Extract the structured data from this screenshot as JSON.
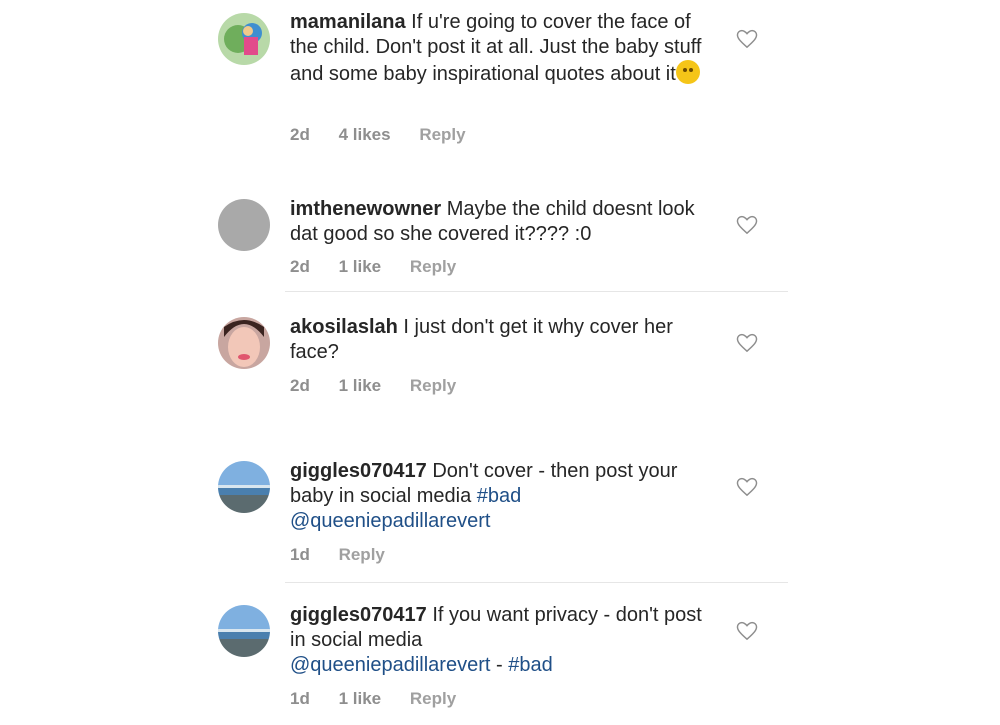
{
  "comments": [
    {
      "username": "mamanilana",
      "text": "If u're going to cover the face of the child. Don't post it at all. Just the baby stuff and some baby inspirational quotes about it",
      "emoji": "smiling-face",
      "time": "2d",
      "likes": "4 likes",
      "reply": "Reply"
    },
    {
      "username": "imthenewowner",
      "text": "Maybe the child doesnt look dat good so she covered it???? :0",
      "time": "2d",
      "likes": "1 like",
      "reply": "Reply"
    },
    {
      "username": "akosilaslah",
      "text": "I just don't get it why cover her face?",
      "time": "2d",
      "likes": "1 like",
      "reply": "Reply"
    },
    {
      "username": "giggles070417",
      "text": "Don't cover - then post your baby in social media",
      "hashtag": "#bad",
      "mention": "@queeniepadillarevert",
      "time": "1d",
      "reply": "Reply"
    },
    {
      "username": "giggles070417",
      "text": "If you want privacy - don't post in social media",
      "mention": "@queeniepadillarevert",
      "separator": " - ",
      "hashtag": "#bad",
      "time": "1d",
      "likes": "1 like",
      "reply": "Reply"
    }
  ],
  "icons": {
    "like": "heart-outline-icon"
  }
}
